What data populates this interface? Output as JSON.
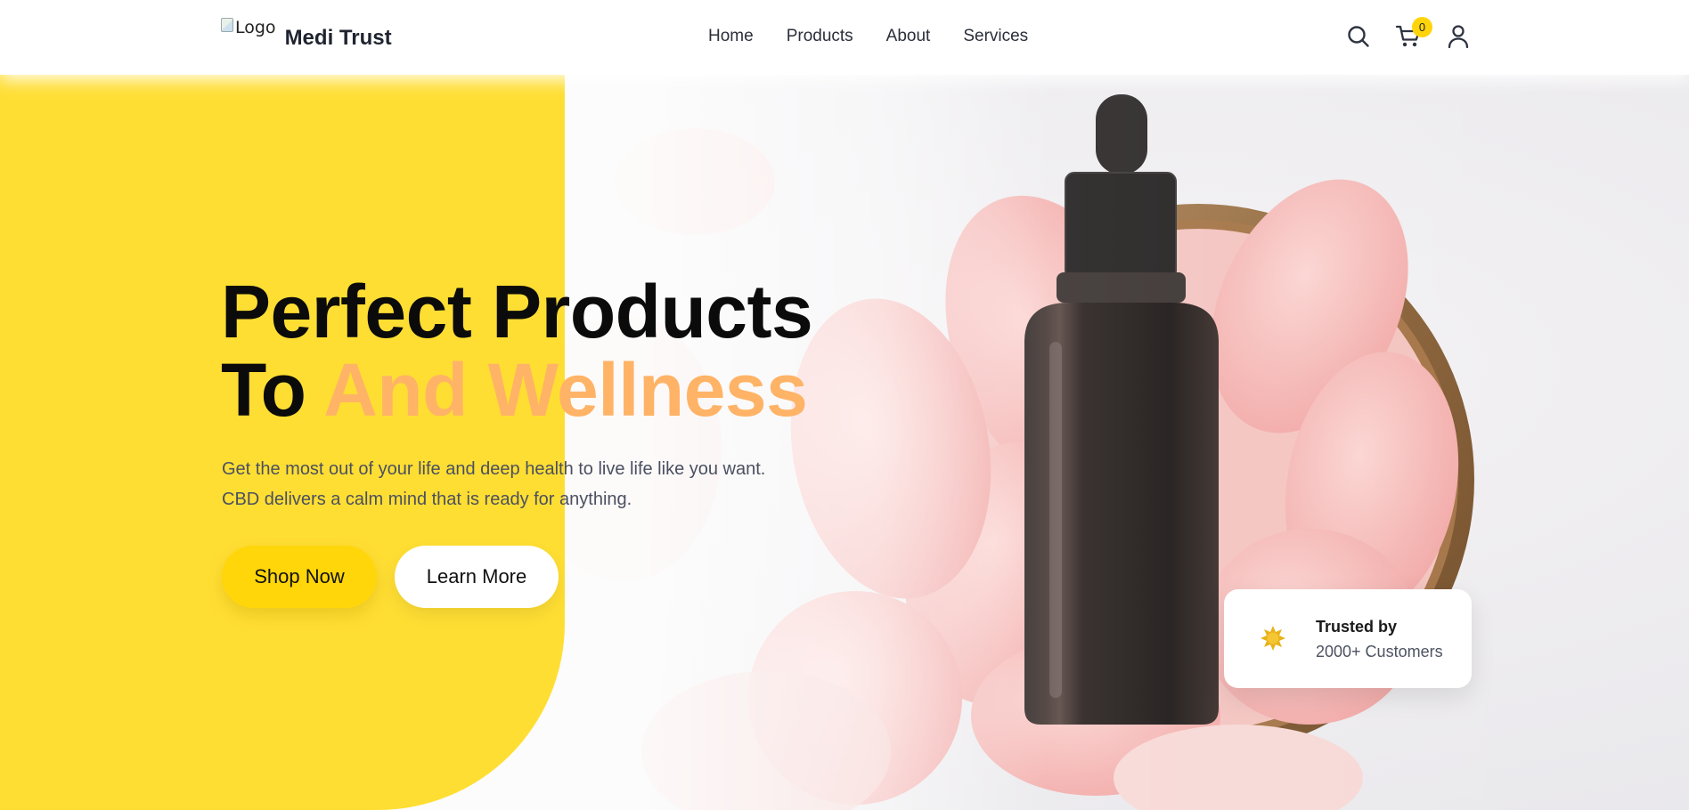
{
  "header": {
    "logo_alt": "Logo",
    "brand": "Medi Trust",
    "nav": [
      "Home",
      "Products",
      "About",
      "Services"
    ],
    "cart_count": "0",
    "icons": [
      "search-icon",
      "cart-icon",
      "user-icon"
    ]
  },
  "hero": {
    "title_line1": "Perfect Products",
    "title_line2_prefix": "To",
    "title_line2_accent": "And Wellness",
    "description_line1": "Get the most out of your life and deep health to live life like you want.",
    "description_line2": "CBD delivers a calm mind that is ready for anything.",
    "shop_button": "Shop Now",
    "learn_button": "Learn More"
  },
  "trust_card": {
    "title": "Trusted by",
    "subtitle": "2000+ Customers",
    "icon": "badge-star-icon"
  },
  "colors": {
    "yellow_panel": "#ffde33",
    "shop_button": "#ffd60a",
    "accent_text": "#ffb366",
    "cart_badge": "#ffd40a"
  }
}
